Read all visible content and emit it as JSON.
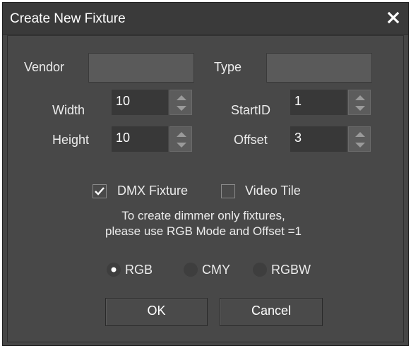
{
  "dialog": {
    "title": "Create New Fixture",
    "close_icon": "close-icon"
  },
  "fields": {
    "vendor_label": "Vendor",
    "vendor_value": "",
    "type_label": "Type",
    "type_value": "",
    "width_label": "Width",
    "width_value": "10",
    "height_label": "Height",
    "height_value": "10",
    "startid_label": "StartID",
    "startid_value": "1",
    "offset_label": "Offset",
    "offset_value": "3"
  },
  "options": {
    "dmx_label": "DMX Fixture",
    "dmx_checked": true,
    "video_label": "Video Tile",
    "video_checked": false
  },
  "note": {
    "line1": "To create dimmer only fixtures,",
    "line2": "please use RGB Mode and Offset =1"
  },
  "mode": {
    "rgb_label": "RGB",
    "cmy_label": "CMY",
    "rgbw_label": "RGBW",
    "selected": "RGB"
  },
  "buttons": {
    "ok_label": "OK",
    "cancel_label": "Cancel"
  },
  "colors": {
    "background": "#464646",
    "input": "#383838",
    "text": "#ececec"
  }
}
